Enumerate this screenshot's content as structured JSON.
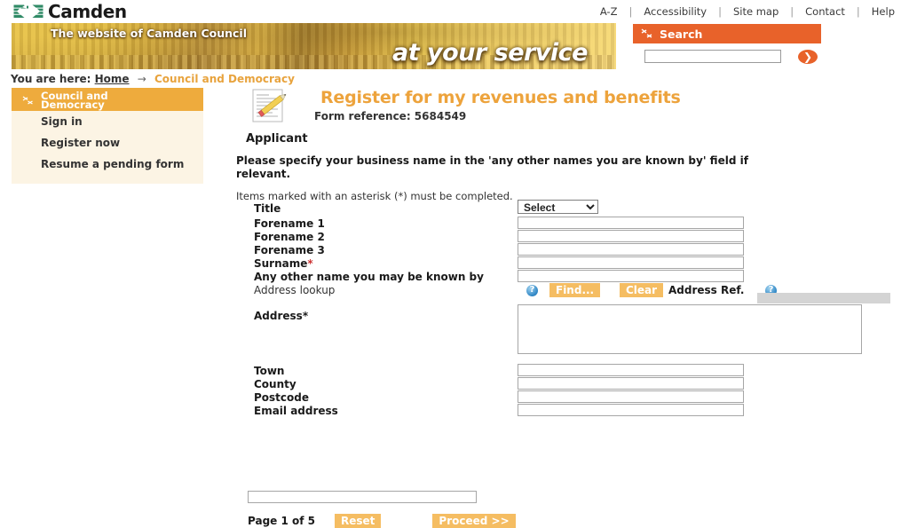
{
  "site": {
    "logo_text": "Camden",
    "logo_icon": "camden-chevrons-logo"
  },
  "top_nav": {
    "items": [
      {
        "label": "A-Z"
      },
      {
        "label": "Accessibility"
      },
      {
        "label": "Site map"
      },
      {
        "label": "Contact"
      },
      {
        "label": "Help"
      }
    ],
    "separator": "|"
  },
  "banner": {
    "tagline": "The website of Camden Council",
    "headline": "at your service"
  },
  "search": {
    "heading": "Search",
    "icon": "search-arrows-icon",
    "value": "",
    "placeholder": "",
    "go_icon": "arrow-right-circle-icon"
  },
  "breadcrumb": {
    "prefix": "You are here:",
    "home": "Home",
    "arrow": "→",
    "current": "Council and Democracy"
  },
  "sidebar": {
    "active": {
      "line1": "Council and",
      "line2": "Democracy",
      "icon": "arrows-bullet-icon"
    },
    "items": [
      {
        "label": "Sign in"
      },
      {
        "label": "Register now"
      },
      {
        "label": "Resume a pending form"
      }
    ]
  },
  "page": {
    "icon": "form-pencil-icon",
    "title": "Register for my revenues and benefits",
    "form_reference": "Form reference: 5684549",
    "section_heading": "Applicant",
    "notice": "Please specify your business name in the 'any other names you are known by' field if relevant.",
    "asterisk_note": "Items marked with an asterisk (*) must be completed."
  },
  "form": {
    "fields": [
      {
        "label": "Title",
        "type": "select",
        "value": "Select",
        "required": false
      },
      {
        "label": "Forename 1",
        "type": "text",
        "value": "",
        "required": false
      },
      {
        "label": "Forename 2",
        "type": "text",
        "value": "",
        "required": false
      },
      {
        "label": "Forename 3",
        "type": "text",
        "value": "",
        "required": false
      },
      {
        "label": "Surname",
        "type": "text",
        "value": "",
        "required": true
      },
      {
        "label": "Any other name you may be known by",
        "type": "text",
        "value": "",
        "required": false
      }
    ],
    "address_lookup": {
      "label": "Address lookup",
      "help_icon": "help-question-icon",
      "find_button": "Find...",
      "clear_button": "Clear",
      "address_ref_label": "Address Ref.",
      "address_ref_help_icon": "help-question-icon",
      "address_ref_value": ""
    },
    "address": {
      "label": "Address",
      "required": true,
      "value": ""
    },
    "lower_fields": [
      {
        "label": "Town",
        "type": "text",
        "value": "",
        "required": false
      },
      {
        "label": "County",
        "type": "text",
        "value": "",
        "required": false
      },
      {
        "label": "Postcode",
        "type": "text",
        "value": "",
        "required": false
      },
      {
        "label": "Email address",
        "type": "text",
        "value": "",
        "required": false
      }
    ],
    "email_extra_value": ""
  },
  "footer": {
    "page_indicator": "Page 1 of 5",
    "reset_button": "Reset",
    "proceed_button": "Proceed >>"
  },
  "colors": {
    "brand_green": "#2f8a66",
    "accent_orange": "#e8622a",
    "amber": "#eeab3d",
    "button_amber": "#f5bd62",
    "title_orange": "#eda33c",
    "sidebar_bg": "#fcf4e4"
  }
}
